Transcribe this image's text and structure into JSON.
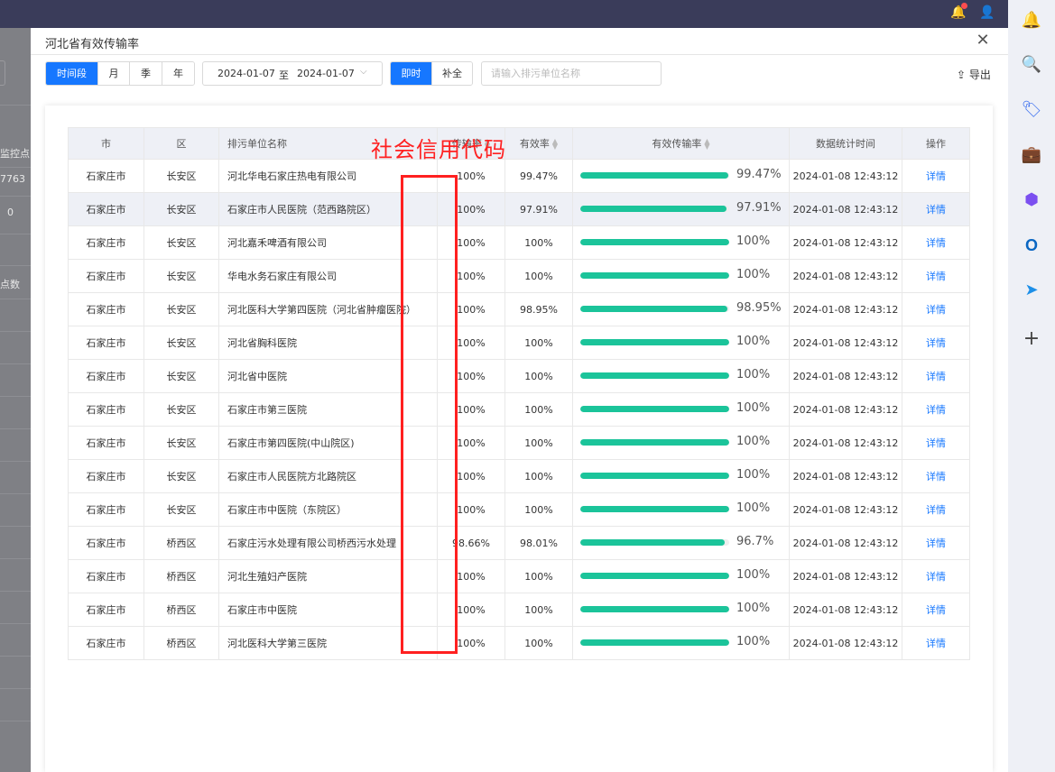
{
  "topbar": {
    "bell_icon": "bell-icon",
    "user_icon": "user-icon"
  },
  "background_page": {
    "header_fragment": "监控点",
    "value1": "7763",
    "value2": "0",
    "label": "点数"
  },
  "modal": {
    "title": "河北省有效传输率",
    "close_icon": "close-icon"
  },
  "toolbar": {
    "period_tabs": [
      "时间段",
      "月",
      "季",
      "年"
    ],
    "period_active": "时间段",
    "date_start": "2024-01-07",
    "date_to": "至",
    "date_end": "2024-01-07",
    "mode_tabs": [
      "即时",
      "补全"
    ],
    "mode_active": "即时",
    "search_placeholder": "请输入排污单位名称",
    "export_label": "导出"
  },
  "table": {
    "columns": [
      "市",
      "区",
      "排污单位名称",
      "传输率",
      "有效率",
      "有效传输率",
      "数据统计时间",
      "操作"
    ],
    "rows": [
      {
        "city": "石家庄市",
        "district": "长安区",
        "name": "河北华电石家庄热电有限公司",
        "transfer": "100%",
        "valid": "99.47%",
        "eff_pct": 99.47,
        "eff": "99.47%",
        "time": "2024-01-08 12:43:12",
        "action": "详情"
      },
      {
        "city": "石家庄市",
        "district": "长安区",
        "name": "石家庄市人民医院（范西路院区）",
        "transfer": "100%",
        "valid": "97.91%",
        "eff_pct": 97.91,
        "eff": "97.91%",
        "time": "2024-01-08 12:43:12",
        "action": "详情"
      },
      {
        "city": "石家庄市",
        "district": "长安区",
        "name": "河北嘉禾啤酒有限公司",
        "transfer": "100%",
        "valid": "100%",
        "eff_pct": 100,
        "eff": "100%",
        "time": "2024-01-08 12:43:12",
        "action": "详情"
      },
      {
        "city": "石家庄市",
        "district": "长安区",
        "name": "华电水务石家庄有限公司",
        "transfer": "100%",
        "valid": "100%",
        "eff_pct": 100,
        "eff": "100%",
        "time": "2024-01-08 12:43:12",
        "action": "详情"
      },
      {
        "city": "石家庄市",
        "district": "长安区",
        "name": "河北医科大学第四医院（河北省肿瘤医院）",
        "transfer": "100%",
        "valid": "98.95%",
        "eff_pct": 98.95,
        "eff": "98.95%",
        "time": "2024-01-08 12:43:12",
        "action": "详情"
      },
      {
        "city": "石家庄市",
        "district": "长安区",
        "name": "河北省胸科医院",
        "transfer": "100%",
        "valid": "100%",
        "eff_pct": 100,
        "eff": "100%",
        "time": "2024-01-08 12:43:12",
        "action": "详情"
      },
      {
        "city": "石家庄市",
        "district": "长安区",
        "name": "河北省中医院",
        "transfer": "100%",
        "valid": "100%",
        "eff_pct": 100,
        "eff": "100%",
        "time": "2024-01-08 12:43:12",
        "action": "详情"
      },
      {
        "city": "石家庄市",
        "district": "长安区",
        "name": "石家庄市第三医院",
        "transfer": "100%",
        "valid": "100%",
        "eff_pct": 100,
        "eff": "100%",
        "time": "2024-01-08 12:43:12",
        "action": "详情"
      },
      {
        "city": "石家庄市",
        "district": "长安区",
        "name": "石家庄市第四医院(中山院区)",
        "transfer": "100%",
        "valid": "100%",
        "eff_pct": 100,
        "eff": "100%",
        "time": "2024-01-08 12:43:12",
        "action": "详情"
      },
      {
        "city": "石家庄市",
        "district": "长安区",
        "name": "石家庄市人民医院方北路院区",
        "transfer": "100%",
        "valid": "100%",
        "eff_pct": 100,
        "eff": "100%",
        "time": "2024-01-08 12:43:12",
        "action": "详情"
      },
      {
        "city": "石家庄市",
        "district": "长安区",
        "name": "石家庄市中医院（东院区）",
        "transfer": "100%",
        "valid": "100%",
        "eff_pct": 100,
        "eff": "100%",
        "time": "2024-01-08 12:43:12",
        "action": "详情"
      },
      {
        "city": "石家庄市",
        "district": "桥西区",
        "name": "石家庄污水处理有限公司桥西污水处理",
        "transfer": "98.66%",
        "valid": "98.01%",
        "eff_pct": 96.7,
        "eff": "96.7%",
        "time": "2024-01-08 12:43:12",
        "action": "详情"
      },
      {
        "city": "石家庄市",
        "district": "桥西区",
        "name": "河北生殖妇产医院",
        "transfer": "100%",
        "valid": "100%",
        "eff_pct": 100,
        "eff": "100%",
        "time": "2024-01-08 12:43:12",
        "action": "详情"
      },
      {
        "city": "石家庄市",
        "district": "桥西区",
        "name": "石家庄市中医院",
        "transfer": "100%",
        "valid": "100%",
        "eff_pct": 100,
        "eff": "100%",
        "time": "2024-01-08 12:43:12",
        "action": "详情"
      },
      {
        "city": "石家庄市",
        "district": "桥西区",
        "name": "河北医科大学第三医院",
        "transfer": "100%",
        "valid": "100%",
        "eff_pct": 100,
        "eff": "100%",
        "time": "2024-01-08 12:43:12",
        "action": "详情"
      }
    ],
    "highlight_row": 1
  },
  "annotation": {
    "text": "社会信用代码",
    "color": "#ff2020"
  },
  "sidebar": {
    "icons": [
      "bell-icon",
      "search-icon",
      "tag-icon",
      "briefcase-icon",
      "copilot-icon",
      "outlook-icon",
      "send-icon",
      "add-icon"
    ]
  },
  "colors": {
    "primary": "#1677ff",
    "progress": "#1bc49a",
    "header_bg": "#eef0f6",
    "topbar": "#3a3c5a"
  }
}
